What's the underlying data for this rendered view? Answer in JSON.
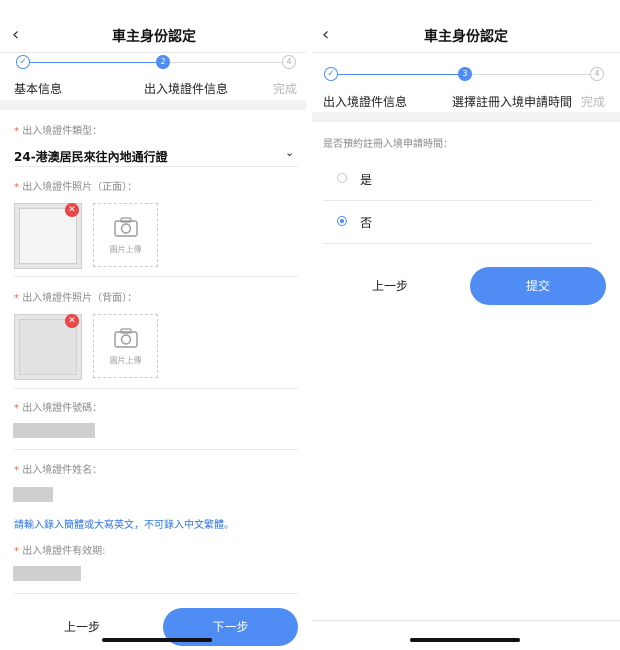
{
  "left": {
    "title": "車主身份認定",
    "back_icon": "chevron-left-icon",
    "steps": [
      {
        "label": "基本信息",
        "state": "done",
        "marker": "✓"
      },
      {
        "label": "出入境證件信息",
        "state": "active",
        "marker": "2"
      },
      {
        "label": "完成",
        "state": "todo",
        "marker": "4"
      }
    ],
    "doc_type": {
      "label": "出入境證件類型：",
      "value": "24-港澳居民來往內地通行證"
    },
    "photo_front": {
      "label": "出入境證件照片（正面）：",
      "upload_text": "圖片上傳"
    },
    "photo_back": {
      "label": "出入境證件照片（背面）：",
      "upload_text": "圖片上傳"
    },
    "doc_number": {
      "label": "出入境證件號碼："
    },
    "doc_name": {
      "label": "出入境證件姓名："
    },
    "name_hint": "請輸入錄入簡體或大寫英文，不可錄入中文繁體。",
    "doc_expiry": {
      "label": "出入境證件有效期:"
    },
    "prev_button": "上一步",
    "next_button": "下一步"
  },
  "right": {
    "title": "車主身份認定",
    "back_icon": "chevron-left-icon",
    "steps": [
      {
        "label": "出入境證件信息",
        "state": "done",
        "marker": "✓"
      },
      {
        "label": "選擇註冊入境申請時間",
        "state": "active",
        "marker": "3"
      },
      {
        "label": "完成",
        "state": "todo",
        "marker": "4"
      }
    ],
    "question": "是否預約註冊入境申請時間：",
    "options": [
      {
        "label": "是",
        "selected": false
      },
      {
        "label": "否",
        "selected": true
      }
    ],
    "prev_button": "上一步",
    "submit_button": "提交"
  },
  "colors": {
    "accent": "#4f8df5",
    "required": "#f0643c",
    "hint": "#2d74e8",
    "delete_badge": "#e84848"
  }
}
